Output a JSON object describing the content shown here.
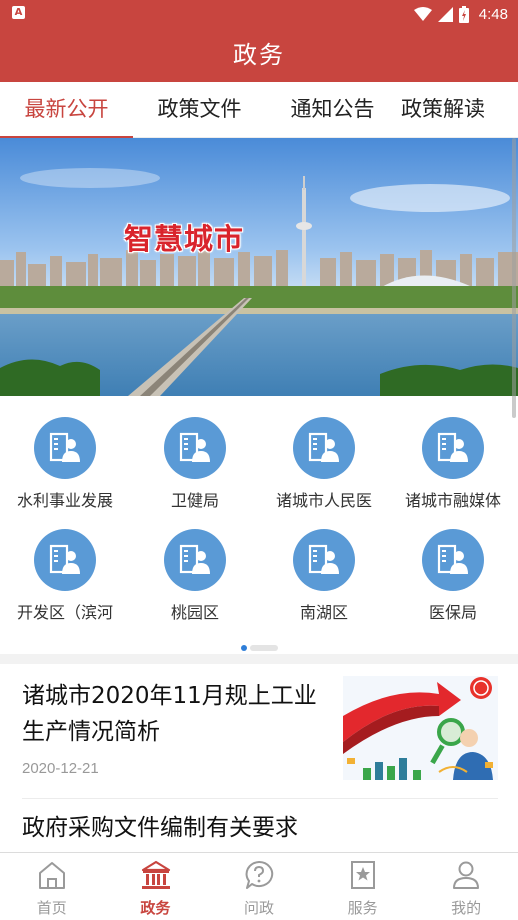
{
  "status_bar": {
    "time": "4:48",
    "app_badge": "A"
  },
  "header": {
    "title": "政务"
  },
  "tabs": [
    {
      "label": "最新公开"
    },
    {
      "label": "政策文件"
    },
    {
      "label": "通知公告"
    },
    {
      "label": "政策解读"
    }
  ],
  "banner": {
    "title": "智慧城市"
  },
  "grid_items": [
    {
      "label": "水利事业发展"
    },
    {
      "label": "卫健局"
    },
    {
      "label": "诸城市人民医"
    },
    {
      "label": "诸城市融媒体"
    },
    {
      "label": "开发区（滨河"
    },
    {
      "label": "桃园区"
    },
    {
      "label": "南湖区"
    },
    {
      "label": "医保局"
    }
  ],
  "news": [
    {
      "title": "诸城市2020年11月规上工业生产情况简析",
      "date": "2020-12-21"
    },
    {
      "title": "政府采购文件编制有关要求"
    }
  ],
  "bottom_nav": [
    {
      "label": "首页",
      "icon": "home-icon"
    },
    {
      "label": "政务",
      "icon": "government-building-icon"
    },
    {
      "label": "问政",
      "icon": "question-bubble-icon"
    },
    {
      "label": "服务",
      "icon": "star-bookmark-icon"
    },
    {
      "label": "我的",
      "icon": "person-icon"
    }
  ],
  "colors": {
    "brand_red": "#c8453f",
    "icon_blue": "#5a9ad6",
    "pager_active": "#2f7ed8"
  }
}
